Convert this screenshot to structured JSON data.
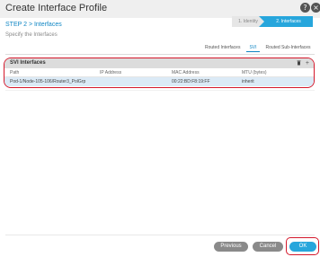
{
  "dialog": {
    "title": "Create Interface Profile"
  },
  "step": {
    "title": "STEP 2 > Interfaces",
    "subtitle": "Specify the Interfaces"
  },
  "wizard": {
    "steps": [
      "1. Identity",
      "2. Interfaces"
    ],
    "active_index": 1
  },
  "tabs": [
    "Routed Interfaces",
    "SVI",
    "Routed Sub-Interfaces"
  ],
  "active_tab": "SVI",
  "svi_panel": {
    "title": "SVI Interfaces",
    "columns": [
      "Path",
      "IP Address",
      "MAC Address",
      "MTU (bytes)"
    ],
    "rows": [
      {
        "path": "Pod-1/Node-105-106/Router3_PolGrp",
        "ip": "",
        "mac": "00:22:BD:F8:19:FF",
        "mtu": "inherit"
      }
    ]
  },
  "buttons": {
    "previous": "Previous",
    "cancel": "Cancel",
    "ok": "OK"
  },
  "icons": {
    "help": "help-icon",
    "close": "close-icon",
    "trash": "trash-icon",
    "add": "add-icon"
  },
  "colors": {
    "accent": "#27a6dc",
    "highlight_outline": "#d4182b",
    "selected_row": "#dbeaf6"
  }
}
